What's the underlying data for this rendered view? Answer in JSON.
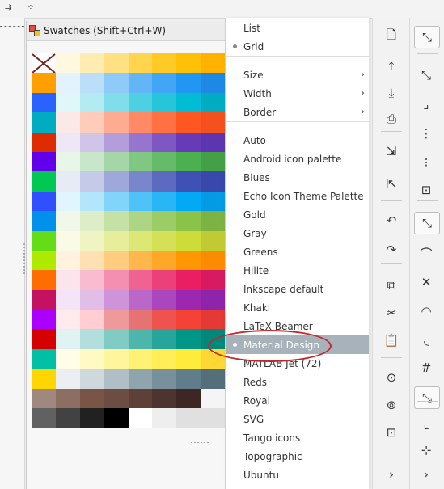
{
  "panel": {
    "title": "Swatches (Shift+Ctrl+W)"
  },
  "menu": {
    "items": [
      {
        "label": "List",
        "bullet": false,
        "arrow": false
      },
      {
        "label": "Grid",
        "bullet": true,
        "arrow": false
      },
      {
        "sep": true
      },
      {
        "label": "Size",
        "bullet": false,
        "arrow": true
      },
      {
        "label": "Width",
        "bullet": false,
        "arrow": true
      },
      {
        "label": "Border",
        "bullet": false,
        "arrow": true
      },
      {
        "sep": true
      },
      {
        "label": "Auto"
      },
      {
        "label": "Android icon palette"
      },
      {
        "label": "Blues"
      },
      {
        "label": "Echo Icon Theme Palette"
      },
      {
        "label": "Gold"
      },
      {
        "label": "Gray"
      },
      {
        "label": "Greens"
      },
      {
        "label": "Hilite"
      },
      {
        "label": "Inkscape default"
      },
      {
        "label": "Khaki"
      },
      {
        "label": "LaTeX Beamer"
      },
      {
        "label": "Material Design",
        "bullet": true,
        "selected": true
      },
      {
        "label": "MATLAB Jet (72)"
      },
      {
        "label": "Reds"
      },
      {
        "label": "Royal"
      },
      {
        "label": "SVG"
      },
      {
        "label": "Tango icons"
      },
      {
        "label": "Topographic"
      },
      {
        "label": "Ubuntu"
      }
    ],
    "arrow_glyph": "›"
  },
  "swatches": [
    [
      "none",
      "#fff8e1",
      "#ffecb3",
      "#ffe082",
      "#ffd54f",
      "#ffca28",
      "#ffc107",
      "#ffb300"
    ],
    [
      "#ffa000",
      "#e3f2fd",
      "#bbdefb",
      "#90caf9",
      "#64b5f6",
      "#42a5f5",
      "#2196f3",
      "#1e88e5"
    ],
    [
      "#2962ff",
      "#e0f7fa",
      "#b2ebf2",
      "#80deea",
      "#4dd0e1",
      "#26c6da",
      "#00bcd4",
      "#00acc1"
    ],
    [
      "#00acc1",
      "#fbe9e7",
      "#ffccbc",
      "#ffab91",
      "#ff8a65",
      "#ff7043",
      "#ff5722",
      "#f4511e"
    ],
    [
      "#dd2c00",
      "#ede7f6",
      "#d1c4e9",
      "#b39ddb",
      "#9575cd",
      "#7e57c2",
      "#673ab7",
      "#5e35b1"
    ],
    [
      "#6200ea",
      "#e8f5e9",
      "#c8e6c9",
      "#a5d6a7",
      "#81c784",
      "#66bb6a",
      "#4caf50",
      "#43a047"
    ],
    [
      "#00c853",
      "#e8eaf6",
      "#c5cae9",
      "#9fa8da",
      "#7986cb",
      "#5c6bc0",
      "#3f51b5",
      "#3949ab"
    ],
    [
      "#304ffe",
      "#e1f5fe",
      "#b3e5fc",
      "#81d4fa",
      "#4fc3f7",
      "#29b6f6",
      "#03a9f4",
      "#039be5"
    ],
    [
      "#0091ea",
      "#f1f8e9",
      "#dcedc8",
      "#c5e1a5",
      "#aed581",
      "#9ccc65",
      "#8bc34a",
      "#7cb342"
    ],
    [
      "#64dd17",
      "#f9fbe7",
      "#f0f4c3",
      "#e6ee9c",
      "#dce775",
      "#d4e157",
      "#cddc39",
      "#c0ca33"
    ],
    [
      "#aeea00",
      "#fff3e0",
      "#ffe0b2",
      "#ffcc80",
      "#ffb74d",
      "#ffa726",
      "#ff9800",
      "#fb8c00"
    ],
    [
      "#ff6d00",
      "#fce4ec",
      "#f8bbd0",
      "#f48fb1",
      "#f06292",
      "#ec407a",
      "#e91e63",
      "#d81b60"
    ],
    [
      "#c51162",
      "#f3e5f5",
      "#e1bee7",
      "#ce93d8",
      "#ba68c8",
      "#ab47bc",
      "#9c27b0",
      "#8e24aa"
    ],
    [
      "#aa00ff",
      "#ffebee",
      "#ffcdd2",
      "#ef9a9a",
      "#e57373",
      "#ef5350",
      "#f44336",
      "#e53935"
    ],
    [
      "#d50000",
      "#e0f2f1",
      "#b2dfdb",
      "#80cbc4",
      "#4db6ac",
      "#26a69a",
      "#009688",
      "#00897b"
    ],
    [
      "#00bfa5",
      "#fffde7",
      "#fff9c4",
      "#fff59d",
      "#fff176",
      "#ffee58",
      "#ffeb3b",
      "#fdd835"
    ],
    [
      "#ffd600",
      "#eceff1",
      "#cfd8dc",
      "#b0bec5",
      "#90a4ae",
      "#78909c",
      "#607d8b",
      "#546e7a"
    ],
    [
      "#a1887f",
      "#8d6e63",
      "#795548",
      "#6d4c41",
      "#5d4037",
      "#4e342e",
      "#3e2723",
      "#f5f5f5"
    ],
    [
      "#616161",
      "#424242",
      "#212121",
      "#000000",
      "#ffffff",
      "#eeeeee",
      "#e0e0e0",
      "#e0e0e0"
    ]
  ],
  "toolbar_icons": [
    "new-document-icon",
    "import-icon",
    "export-icon",
    "print-icon",
    "import-other-icon",
    "export-other-icon",
    "undo-icon",
    "redo-icon",
    "copy-icon",
    "cut-icon",
    "paste-icon",
    "zoom-selection-icon",
    "zoom-drawing-icon",
    "zoom-page-icon"
  ],
  "snap_icons": [
    "snap-toggle-icon",
    "snap-nodes-icon",
    "snap-bbox-corner-icon",
    "snap-bbox-edge-icon",
    "snap-bbox-midpoint-icon",
    "snap-bbox-center-icon",
    "snap-paths-icon",
    "snap-path-curve-icon",
    "snap-intersection-icon",
    "snap-smooth-node-icon",
    "snap-line-midpoint-icon",
    "snap-hash-icon",
    "snap-others-icon",
    "snap-center-icon",
    "snap-rotation-icon"
  ],
  "more_glyph": "›"
}
